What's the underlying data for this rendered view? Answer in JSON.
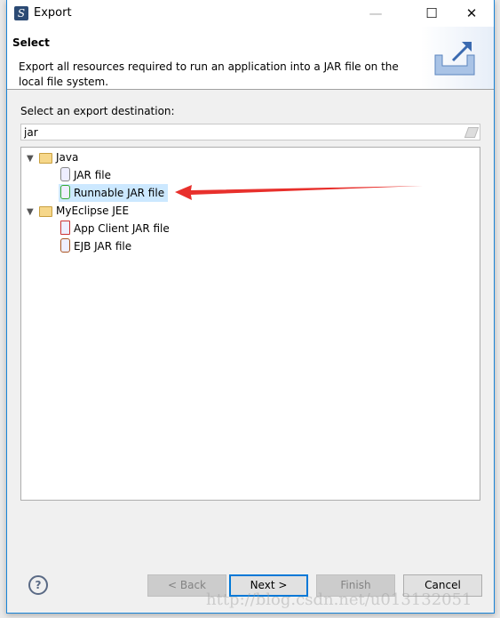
{
  "window": {
    "title": "Export",
    "minimize": "—",
    "maximize": "☐",
    "close": "✕"
  },
  "header": {
    "title": "Select",
    "description": "Export all resources required to run an application into a JAR file on the local file system."
  },
  "label": "Select an export destination:",
  "search": {
    "value": "jar"
  },
  "tree": [
    {
      "label": "Java",
      "type": "folder",
      "children": [
        {
          "label": "JAR file"
        },
        {
          "label": "Runnable JAR file",
          "selected": true
        }
      ]
    },
    {
      "label": "MyEclipse JEE",
      "type": "folder",
      "children": [
        {
          "label": "App Client JAR file"
        },
        {
          "label": "EJB JAR file"
        }
      ]
    }
  ],
  "buttons": {
    "back": "< Back",
    "next": "Next >",
    "finish": "Finish",
    "cancel": "Cancel",
    "help": "?"
  },
  "annotation": {
    "arrow_color": "#e8302c"
  },
  "watermark": "http://blog.csdn.net/u013132051"
}
